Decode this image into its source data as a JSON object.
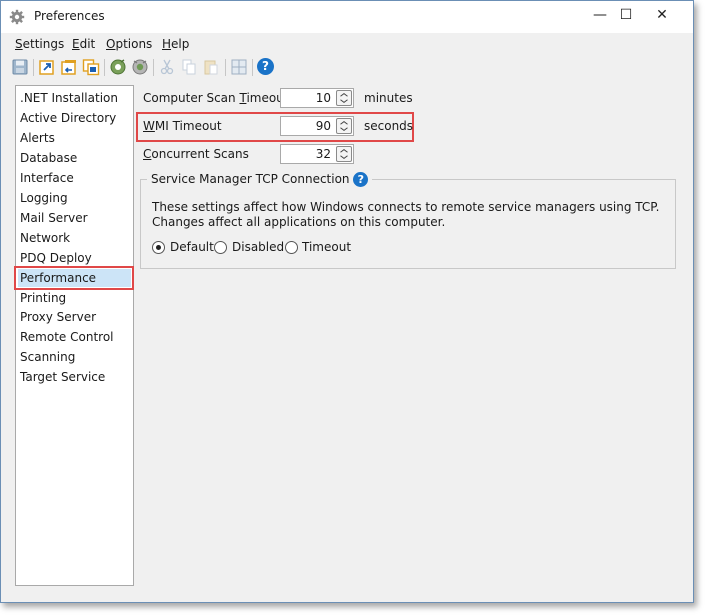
{
  "window": {
    "title": "Preferences",
    "minimize_label": "—",
    "maximize_label": "☐",
    "close_label": "✕"
  },
  "menu": {
    "items": [
      {
        "pre": "",
        "ul": "S",
        "post": "ettings"
      },
      {
        "pre": "",
        "ul": "E",
        "post": "dit"
      },
      {
        "pre": "",
        "ul": "O",
        "post": "ptions"
      },
      {
        "pre": "",
        "ul": "H",
        "post": "elp"
      }
    ]
  },
  "toolbar": {
    "icons": [
      "save-icon",
      "export-icon",
      "import-icon",
      "copy-settings-icon",
      "scan-icon",
      "scan-all-icon",
      "cut-icon",
      "copy-icon",
      "paste-icon",
      "grid-icon",
      "help-icon"
    ],
    "help_glyph": "?"
  },
  "sidebar": {
    "items": [
      {
        "label": ".NET Installation"
      },
      {
        "label": "Active Directory"
      },
      {
        "label": "Alerts"
      },
      {
        "label": "Database"
      },
      {
        "label": "Interface"
      },
      {
        "label": "Logging"
      },
      {
        "label": "Mail Server"
      },
      {
        "label": "Network"
      },
      {
        "label": "PDQ Deploy"
      },
      {
        "label": "Performance",
        "selected": true
      },
      {
        "label": "Printing"
      },
      {
        "label": "Proxy Server"
      },
      {
        "label": "Remote Control"
      },
      {
        "label": "Scanning"
      },
      {
        "label": "Target Service"
      }
    ]
  },
  "settings": {
    "computer_scan_timeout": {
      "label_pre": "Computer Scan ",
      "label_ul": "T",
      "label_post": "imeout",
      "value": "10",
      "unit": "minutes"
    },
    "wmi_timeout": {
      "label_pre": "",
      "label_ul": "W",
      "label_post": "MI Timeout",
      "value": "90",
      "unit": "seconds"
    },
    "concurrent_scans": {
      "label_pre": "",
      "label_ul": "C",
      "label_post": "oncurrent Scans",
      "value": "32",
      "unit": ""
    }
  },
  "tcp_group": {
    "title": "Service Manager TCP Connection",
    "help_glyph": "?",
    "description": "These settings affect how Windows connects to remote service managers using TCP. Changes affect all applications on this computer.",
    "options": [
      {
        "label": "Default",
        "checked": true
      },
      {
        "label": "Disabled",
        "checked": false
      },
      {
        "label": "Timeout",
        "checked": false
      }
    ]
  },
  "colors": {
    "highlight": "#e04848",
    "selection": "#cce4f7",
    "help_blue": "#1a73c8"
  }
}
